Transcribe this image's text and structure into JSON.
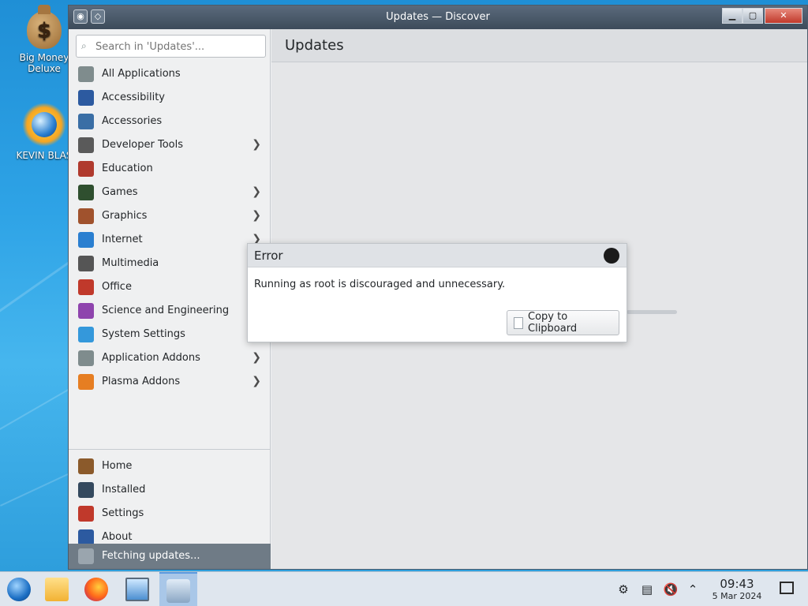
{
  "desktop": {
    "icons": [
      {
        "label": "Big Money Deluxe",
        "icon": "money-bag-icon"
      },
      {
        "label": "KEVIN BLAS",
        "icon": "sun-globe-icon"
      }
    ]
  },
  "window": {
    "title": "Updates — Discover",
    "controls": {
      "minimize": "▁",
      "maximize": "▢",
      "close": "✕"
    }
  },
  "search": {
    "placeholder": "Search in 'Updates'..."
  },
  "categories": [
    {
      "label": "All Applications",
      "icon": "all-apps-icon",
      "color": "#7f8c8d",
      "has_children": false
    },
    {
      "label": "Accessibility",
      "icon": "accessibility-icon",
      "color": "#2c5aa0",
      "has_children": false
    },
    {
      "label": "Accessories",
      "icon": "accessories-icon",
      "color": "#3a6ea5",
      "has_children": false
    },
    {
      "label": "Developer Tools",
      "icon": "developer-tools-icon",
      "color": "#5a5a5a",
      "has_children": true
    },
    {
      "label": "Education",
      "icon": "education-icon",
      "color": "#b03a2e",
      "has_children": false
    },
    {
      "label": "Games",
      "icon": "games-icon",
      "color": "#2f4f2f",
      "has_children": true
    },
    {
      "label": "Graphics",
      "icon": "graphics-icon",
      "color": "#a0522d",
      "has_children": true
    },
    {
      "label": "Internet",
      "icon": "internet-icon",
      "color": "#2a7fd0",
      "has_children": true
    },
    {
      "label": "Multimedia",
      "icon": "multimedia-icon",
      "color": "#555555",
      "has_children": false
    },
    {
      "label": "Office",
      "icon": "office-icon",
      "color": "#c0392b",
      "has_children": false
    },
    {
      "label": "Science and Engineering",
      "icon": "science-icon",
      "color": "#8e44ad",
      "has_children": false
    },
    {
      "label": "System Settings",
      "icon": "system-settings-icon",
      "color": "#3498db",
      "has_children": false
    },
    {
      "label": "Application Addons",
      "icon": "application-addons-icon",
      "color": "#7f8c8d",
      "has_children": true
    },
    {
      "label": "Plasma Addons",
      "icon": "plasma-addons-icon",
      "color": "#e67e22",
      "has_children": true
    }
  ],
  "nav": [
    {
      "label": "Home",
      "icon": "home-icon",
      "color": "#8b5a2b"
    },
    {
      "label": "Installed",
      "icon": "installed-icon",
      "color": "#34495e"
    },
    {
      "label": "Settings",
      "icon": "settings-icon",
      "color": "#c0392b"
    },
    {
      "label": "About",
      "icon": "info-icon",
      "color": "#2c5aa0"
    }
  ],
  "status": {
    "fetching": "Fetching updates..."
  },
  "content": {
    "title": "Updates"
  },
  "dialog": {
    "title": "Error",
    "message": "Running as root is discouraged and unnecessary.",
    "copy_label": "Copy to Clipboard"
  },
  "taskbar": {
    "apps": [
      {
        "name": "start-menu",
        "icon": "start-orb-icon"
      },
      {
        "name": "file-manager",
        "icon": "folder-icon"
      },
      {
        "name": "firefox",
        "icon": "firefox-icon"
      },
      {
        "name": "system-monitor",
        "icon": "monitor-icon"
      },
      {
        "name": "discover",
        "icon": "discover-icon",
        "active": true
      }
    ],
    "clock": {
      "time": "09:43",
      "date": "5 Mar 2024"
    }
  }
}
